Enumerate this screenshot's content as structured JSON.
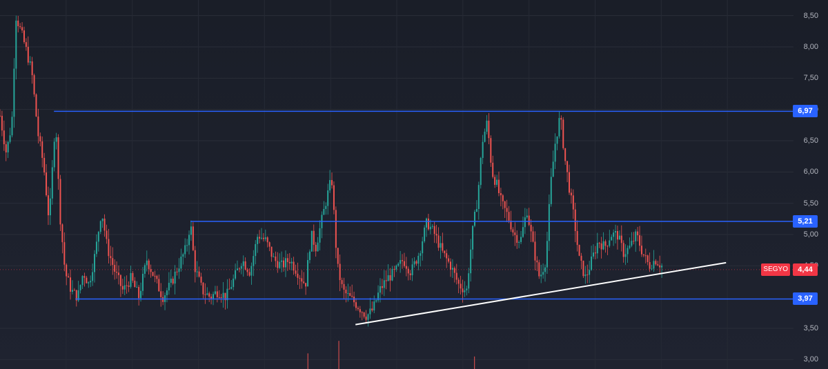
{
  "chart_data": {
    "type": "candlestick",
    "symbol": "SEGYO",
    "last_price": "4,44",
    "ylim": [
      2.85,
      8.75
    ],
    "y_ticks": [
      "8,50",
      "8,00",
      "7,50",
      "7,00",
      "6,50",
      "6,00",
      "5,50",
      "5,00",
      "4,50",
      "3,50",
      "3,00"
    ],
    "y_tick_values": [
      8.5,
      8.0,
      7.5,
      7.0,
      6.5,
      6.0,
      5.5,
      5.0,
      4.5,
      3.5,
      3.0
    ],
    "levels": [
      {
        "label": "6,97",
        "value": 6.97,
        "x_start": 0.068
      },
      {
        "label": "5,21",
        "value": 5.21,
        "x_start": 0.24
      },
      {
        "label": "3,97",
        "value": 3.97,
        "x_start": 0.095
      }
    ],
    "trendline": {
      "from": [
        0.448,
        3.56
      ],
      "to": [
        0.915,
        4.55
      ]
    },
    "price_path": [
      [
        0.0,
        6.9
      ],
      [
        0.008,
        6.3
      ],
      [
        0.015,
        6.8
      ],
      [
        0.02,
        8.5
      ],
      [
        0.025,
        8.3
      ],
      [
        0.032,
        8.0
      ],
      [
        0.04,
        7.6
      ],
      [
        0.048,
        6.6
      ],
      [
        0.055,
        6.1
      ],
      [
        0.062,
        5.2
      ],
      [
        0.07,
        6.9
      ],
      [
        0.075,
        5.4
      ],
      [
        0.082,
        4.4
      ],
      [
        0.09,
        4.1
      ],
      [
        0.098,
        4.0
      ],
      [
        0.105,
        4.4
      ],
      [
        0.112,
        4.2
      ],
      [
        0.12,
        4.7
      ],
      [
        0.128,
        5.4
      ],
      [
        0.135,
        4.8
      ],
      [
        0.145,
        4.4
      ],
      [
        0.155,
        4.1
      ],
      [
        0.165,
        4.3
      ],
      [
        0.175,
        4.0
      ],
      [
        0.185,
        4.6
      ],
      [
        0.195,
        4.3
      ],
      [
        0.205,
        4.0
      ],
      [
        0.215,
        4.2
      ],
      [
        0.225,
        4.5
      ],
      [
        0.235,
        4.8
      ],
      [
        0.24,
        5.2
      ],
      [
        0.245,
        4.5
      ],
      [
        0.255,
        4.1
      ],
      [
        0.265,
        4.0
      ],
      [
        0.275,
        4.1
      ],
      [
        0.285,
        4.0
      ],
      [
        0.295,
        4.3
      ],
      [
        0.305,
        4.6
      ],
      [
        0.315,
        4.4
      ],
      [
        0.325,
        5.0
      ],
      [
        0.335,
        4.9
      ],
      [
        0.345,
        4.6
      ],
      [
        0.355,
        4.5
      ],
      [
        0.365,
        4.6
      ],
      [
        0.375,
        4.4
      ],
      [
        0.385,
        4.2
      ],
      [
        0.392,
        5.0
      ],
      [
        0.398,
        4.8
      ],
      [
        0.405,
        5.2
      ],
      [
        0.412,
        5.6
      ],
      [
        0.418,
        5.9
      ],
      [
        0.425,
        4.5
      ],
      [
        0.432,
        4.1
      ],
      [
        0.44,
        4.0
      ],
      [
        0.448,
        3.9
      ],
      [
        0.455,
        3.8
      ],
      [
        0.462,
        3.7
      ],
      [
        0.47,
        3.8
      ],
      [
        0.478,
        4.1
      ],
      [
        0.488,
        4.3
      ],
      [
        0.498,
        4.4
      ],
      [
        0.508,
        4.6
      ],
      [
        0.518,
        4.4
      ],
      [
        0.528,
        4.7
      ],
      [
        0.538,
        5.2
      ],
      [
        0.548,
        5.0
      ],
      [
        0.558,
        4.7
      ],
      [
        0.568,
        4.5
      ],
      [
        0.578,
        4.2
      ],
      [
        0.588,
        4.1
      ],
      [
        0.595,
        5.0
      ],
      [
        0.602,
        5.6
      ],
      [
        0.608,
        6.5
      ],
      [
        0.614,
        6.8
      ],
      [
        0.62,
        6.0
      ],
      [
        0.626,
        5.8
      ],
      [
        0.632,
        5.5
      ],
      [
        0.64,
        5.3
      ],
      [
        0.648,
        5.0
      ],
      [
        0.656,
        4.9
      ],
      [
        0.664,
        5.4
      ],
      [
        0.672,
        4.8
      ],
      [
        0.68,
        4.3
      ],
      [
        0.688,
        4.6
      ],
      [
        0.694,
        5.8
      ],
      [
        0.7,
        6.5
      ],
      [
        0.706,
        6.9
      ],
      [
        0.712,
        6.2
      ],
      [
        0.718,
        5.7
      ],
      [
        0.724,
        5.2
      ],
      [
        0.73,
        4.6
      ],
      [
        0.738,
        4.3
      ],
      [
        0.746,
        4.6
      ],
      [
        0.754,
        4.9
      ],
      [
        0.762,
        4.8
      ],
      [
        0.77,
        5.0
      ],
      [
        0.778,
        5.0
      ],
      [
        0.786,
        4.7
      ],
      [
        0.794,
        4.8
      ],
      [
        0.802,
        5.0
      ],
      [
        0.81,
        4.7
      ],
      [
        0.818,
        4.5
      ],
      [
        0.826,
        4.6
      ],
      [
        0.834,
        4.5
      ]
    ]
  }
}
